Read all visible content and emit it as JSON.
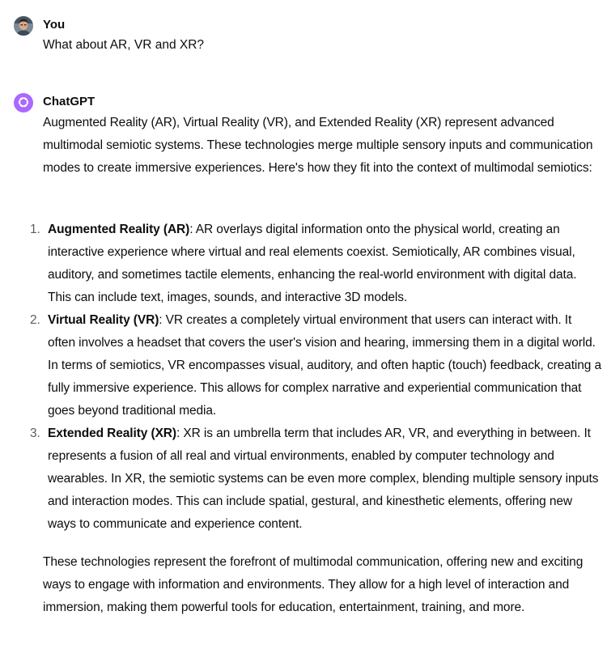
{
  "user_message": {
    "author": "You",
    "text": "What about AR, VR and XR?",
    "avatar_icon": "user-photo-avatar"
  },
  "assistant_message": {
    "author": "ChatGPT",
    "avatar_icon": "openai-logo-icon",
    "avatar_color": "#ab68ff",
    "intro": "Augmented Reality (AR), Virtual Reality (VR), and Extended Reality (XR) represent advanced multimodal semiotic systems. These technologies merge multiple sensory inputs and communication modes to create immersive experiences. Here's how they fit into the context of multimodal semiotics:",
    "items": [
      {
        "number": "1.",
        "title": "Augmented Reality (AR)",
        "text": ": AR overlays digital information onto the physical world, creating an interactive experience where virtual and real elements coexist. Semiotically, AR combines visual, auditory, and sometimes tactile elements, enhancing the real-world environment with digital data. This can include text, images, sounds, and interactive 3D models."
      },
      {
        "number": "2.",
        "title": "Virtual Reality (VR)",
        "text": ": VR creates a completely virtual environment that users can interact with. It often involves a headset that covers the user's vision and hearing, immersing them in a digital world. In terms of semiotics, VR encompasses visual, auditory, and often haptic (touch) feedback, creating a fully immersive experience. This allows for complex narrative and experiential communication that goes beyond traditional media."
      },
      {
        "number": "3.",
        "title": "Extended Reality (XR)",
        "text": ": XR is an umbrella term that includes AR, VR, and everything in between. It represents a fusion of all real and virtual environments, enabled by computer technology and wearables. In XR, the semiotic systems can be even more complex, blending multiple sensory inputs and interaction modes. This can include spatial, gestural, and kinesthetic elements, offering new ways to communicate and experience content."
      }
    ],
    "conclusion": "These technologies represent the forefront of multimodal communication, offering new and exciting ways to engage with information and environments. They allow for a high level of interaction and immersion, making them powerful tools for education, entertainment, training, and more."
  }
}
